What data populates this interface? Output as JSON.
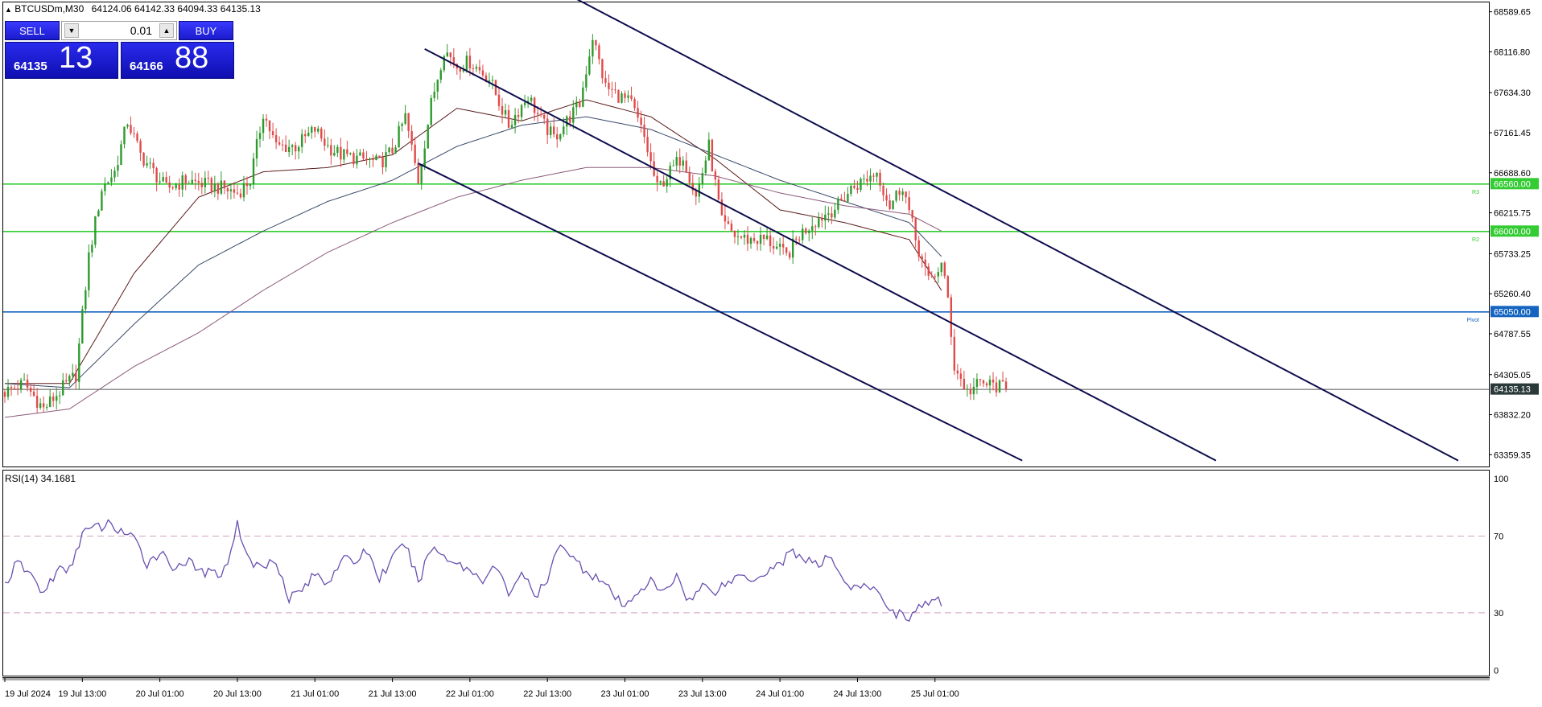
{
  "chart_header": {
    "symbol_text": "BTCUSDm,M30",
    "ohlc_text": "64124.06 64142.33 64094.33 64135.13"
  },
  "trade_panel": {
    "sell_label": "SELL",
    "buy_label": "BUY",
    "lot_value": "0.01",
    "sell_price_small": "64135",
    "sell_price_big": "13",
    "buy_price_small": "64166",
    "buy_price_big": "88"
  },
  "rsi_panel": {
    "label_text": "RSI(14) 34.1681"
  },
  "colors": {
    "bull": "#2e9a2e",
    "bear": "#e04a4a",
    "level_green": "#33cc33",
    "pivot_blue": "#1565c0",
    "channel": "#0d0d4d",
    "rsi_line": "#6a50b0",
    "rsi_level": "#d4a0c0"
  },
  "chart_data": [
    {
      "type": "candlestick",
      "instrument": "BTCUSDm",
      "timeframe": "M30",
      "last_price": 64135.13,
      "y_ticks": [
        68589.65,
        68116.8,
        67634.3,
        67161.45,
        66688.6,
        66215.75,
        65733.25,
        65260.4,
        64787.55,
        64305.05,
        63832.2,
        63359.35
      ],
      "ylim": [
        63220,
        68700
      ],
      "x_labels": [
        "19 Jul 2024",
        "19 Jul 13:00",
        "20 Jul 01:00",
        "20 Jul 13:00",
        "21 Jul 01:00",
        "21 Jul 13:00",
        "22 Jul 01:00",
        "22 Jul 13:00",
        "23 Jul 01:00",
        "23 Jul 13:00",
        "24 Jul 01:00",
        "24 Jul 13:00",
        "25 Jul 01:00"
      ],
      "x_label_bars": [
        0,
        24,
        48,
        72,
        96,
        120,
        144,
        168,
        192,
        216,
        240,
        264,
        288
      ],
      "total_bars_in_view": 460,
      "close_anchors": [
        [
          0,
          64100
        ],
        [
          6,
          64200
        ],
        [
          12,
          63900
        ],
        [
          18,
          64150
        ],
        [
          22,
          64300
        ],
        [
          26,
          65700
        ],
        [
          30,
          66500
        ],
        [
          34,
          66700
        ],
        [
          38,
          67300
        ],
        [
          42,
          66900
        ],
        [
          46,
          66700
        ],
        [
          50,
          66500
        ],
        [
          56,
          66600
        ],
        [
          62,
          66550
        ],
        [
          68,
          66500
        ],
        [
          72,
          66450
        ],
        [
          76,
          66600
        ],
        [
          80,
          67400
        ],
        [
          84,
          67000
        ],
        [
          90,
          67000
        ],
        [
          96,
          67200
        ],
        [
          100,
          67000
        ],
        [
          104,
          66900
        ],
        [
          110,
          66850
        ],
        [
          116,
          66800
        ],
        [
          120,
          66950
        ],
        [
          124,
          67350
        ],
        [
          128,
          66600
        ],
        [
          132,
          67500
        ],
        [
          136,
          68150
        ],
        [
          140,
          67950
        ],
        [
          144,
          68000
        ],
        [
          150,
          67800
        ],
        [
          156,
          67250
        ],
        [
          162,
          67600
        ],
        [
          166,
          67300
        ],
        [
          170,
          67100
        ],
        [
          174,
          67300
        ],
        [
          178,
          67500
        ],
        [
          182,
          68300
        ],
        [
          186,
          67700
        ],
        [
          190,
          67600
        ],
        [
          194,
          67500
        ],
        [
          198,
          67100
        ],
        [
          202,
          66500
        ],
        [
          206,
          66700
        ],
        [
          210,
          66900
        ],
        [
          214,
          66400
        ],
        [
          218,
          67000
        ],
        [
          222,
          66100
        ],
        [
          226,
          65950
        ],
        [
          230,
          65900
        ],
        [
          236,
          65900
        ],
        [
          242,
          65700
        ],
        [
          246,
          65950
        ],
        [
          250,
          66100
        ],
        [
          254,
          66200
        ],
        [
          258,
          66300
        ],
        [
          262,
          66500
        ],
        [
          266,
          66600
        ],
        [
          270,
          66700
        ],
        [
          274,
          66300
        ],
        [
          278,
          66550
        ],
        [
          282,
          65900
        ],
        [
          286,
          65400
        ],
        [
          290,
          65600
        ],
        [
          292,
          65200
        ],
        [
          294,
          64400
        ],
        [
          298,
          64100
        ],
        [
          302,
          64200
        ],
        [
          306,
          64180
        ],
        [
          310,
          64135
        ]
      ],
      "ma_anchors": {
        "fast": [
          [
            0,
            64200
          ],
          [
            20,
            64200
          ],
          [
            40,
            65500
          ],
          [
            60,
            66400
          ],
          [
            80,
            66700
          ],
          [
            100,
            66750
          ],
          [
            120,
            66900
          ],
          [
            140,
            67450
          ],
          [
            160,
            67300
          ],
          [
            180,
            67550
          ],
          [
            200,
            67350
          ],
          [
            220,
            66850
          ],
          [
            240,
            66250
          ],
          [
            260,
            66100
          ],
          [
            280,
            65900
          ],
          [
            290,
            65300
          ]
        ],
        "mid": [
          [
            0,
            64200
          ],
          [
            20,
            64150
          ],
          [
            40,
            64900
          ],
          [
            60,
            65600
          ],
          [
            80,
            66000
          ],
          [
            100,
            66350
          ],
          [
            120,
            66600
          ],
          [
            140,
            67000
          ],
          [
            160,
            67250
          ],
          [
            180,
            67350
          ],
          [
            200,
            67200
          ],
          [
            220,
            66900
          ],
          [
            240,
            66600
          ],
          [
            260,
            66350
          ],
          [
            280,
            66100
          ],
          [
            290,
            65700
          ]
        ],
        "slow": [
          [
            0,
            63800
          ],
          [
            20,
            63900
          ],
          [
            40,
            64400
          ],
          [
            60,
            64800
          ],
          [
            80,
            65300
          ],
          [
            100,
            65750
          ],
          [
            120,
            66100
          ],
          [
            140,
            66400
          ],
          [
            160,
            66600
          ],
          [
            180,
            66750
          ],
          [
            200,
            66750
          ],
          [
            220,
            66650
          ],
          [
            240,
            66450
          ],
          [
            260,
            66300
          ],
          [
            280,
            66200
          ],
          [
            290,
            66000
          ]
        ]
      },
      "horizontal_levels": [
        {
          "price": 66560.0,
          "label": "66560.00",
          "tag": "R3",
          "color": "#33cc33"
        },
        {
          "price": 66000.0,
          "label": "66000.00",
          "tag": "R2",
          "color": "#33cc33"
        },
        {
          "price": 65050.0,
          "label": "65050.00",
          "tag": "Pivot",
          "color": "#1565c0"
        },
        {
          "price": 64135.13,
          "label": "64135.13",
          "tag": "",
          "color": "#555555"
        }
      ],
      "trend_channel": [
        {
          "x1": 164,
          "y1": 69000,
          "x2": 450,
          "y2": 63290
        },
        {
          "x1": 130,
          "y1": 68150,
          "x2": 375,
          "y2": 63290
        },
        {
          "x1": 128,
          "y1": 66800,
          "x2": 315,
          "y2": 63290
        }
      ]
    },
    {
      "type": "line",
      "name": "RSI(14)",
      "last_value": 34.1681,
      "y_ticks": [
        100,
        70,
        30,
        0
      ],
      "ylim": [
        0,
        100
      ],
      "levels": [
        70,
        30
      ],
      "anchors": [
        [
          0,
          45
        ],
        [
          4,
          56
        ],
        [
          8,
          50
        ],
        [
          12,
          40
        ],
        [
          16,
          52
        ],
        [
          20,
          52
        ],
        [
          24,
          72
        ],
        [
          28,
          74
        ],
        [
          32,
          76
        ],
        [
          36,
          73
        ],
        [
          40,
          68
        ],
        [
          44,
          56
        ],
        [
          48,
          62
        ],
        [
          52,
          54
        ],
        [
          56,
          57
        ],
        [
          60,
          52
        ],
        [
          64,
          50
        ],
        [
          68,
          52
        ],
        [
          72,
          76
        ],
        [
          76,
          56
        ],
        [
          80,
          54
        ],
        [
          84,
          58
        ],
        [
          88,
          38
        ],
        [
          92,
          42
        ],
        [
          96,
          50
        ],
        [
          100,
          46
        ],
        [
          104,
          58
        ],
        [
          108,
          56
        ],
        [
          112,
          63
        ],
        [
          116,
          48
        ],
        [
          120,
          58
        ],
        [
          124,
          66
        ],
        [
          128,
          46
        ],
        [
          132,
          64
        ],
        [
          136,
          60
        ],
        [
          140,
          56
        ],
        [
          144,
          52
        ],
        [
          148,
          48
        ],
        [
          152,
          54
        ],
        [
          156,
          40
        ],
        [
          160,
          52
        ],
        [
          164,
          38
        ],
        [
          168,
          46
        ],
        [
          172,
          68
        ],
        [
          176,
          58
        ],
        [
          180,
          52
        ],
        [
          184,
          48
        ],
        [
          188,
          40
        ],
        [
          192,
          32
        ],
        [
          196,
          42
        ],
        [
          200,
          46
        ],
        [
          204,
          40
        ],
        [
          208,
          50
        ],
        [
          212,
          36
        ],
        [
          216,
          44
        ],
        [
          220,
          42
        ],
        [
          224,
          46
        ],
        [
          228,
          50
        ],
        [
          232,
          48
        ],
        [
          236,
          52
        ],
        [
          240,
          56
        ],
        [
          244,
          62
        ],
        [
          248,
          58
        ],
        [
          252,
          54
        ],
        [
          256,
          60
        ],
        [
          260,
          46
        ],
        [
          264,
          42
        ],
        [
          268,
          44
        ],
        [
          272,
          36
        ],
        [
          276,
          30
        ],
        [
          280,
          28
        ],
        [
          284,
          34
        ],
        [
          290,
          36
        ]
      ]
    }
  ]
}
